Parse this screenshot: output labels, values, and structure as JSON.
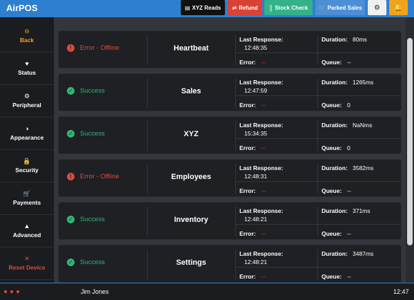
{
  "header": {
    "app_title": "AirPOS",
    "buttons": {
      "xyz_reads": {
        "label": "XYZ Reads",
        "icon": "receipt-icon"
      },
      "refund": {
        "label": "Refund",
        "icon": "refund-icon"
      },
      "stock_check": {
        "label": "Stock Check",
        "icon": "barcode-icon"
      },
      "parked_sales": {
        "label": "Parked Sales",
        "icon": "cart-icon"
      },
      "settings": {
        "icon": "gear-icon"
      },
      "notifications": {
        "icon": "bell-icon"
      }
    },
    "colors": {
      "bar": "#2f7fcf",
      "refund": "#d94336",
      "stock_check": "#33b28a",
      "parked_sales": "#4d8fd6",
      "notifications": "#f0a21e"
    }
  },
  "sidebar": {
    "items": [
      {
        "label": "Back",
        "icon": "back-icon"
      },
      {
        "label": "Status",
        "icon": "heart-pulse-icon"
      },
      {
        "label": "Peripheral",
        "icon": "gear-icon"
      },
      {
        "label": "Appearance",
        "icon": "contrast-icon"
      },
      {
        "label": "Security",
        "icon": "lock-icon"
      },
      {
        "label": "Payments",
        "icon": "cart-icon"
      },
      {
        "label": "Advanced",
        "icon": "warning-icon"
      },
      {
        "label": "Reset Device",
        "icon": "close-icon"
      }
    ]
  },
  "labels": {
    "last_response": "Last Response:",
    "duration": "Duration:",
    "error": "Error:",
    "queue": "Queue:"
  },
  "services": [
    {
      "status": "Error - Offline",
      "state": "error",
      "name": "Heartbeat",
      "last_response": "12:48:35",
      "duration": "80ms",
      "error": "--",
      "queue": "--"
    },
    {
      "status": "Success",
      "state": "success",
      "name": "Sales",
      "last_response": "12:47:59",
      "duration": "1265ms",
      "error": "--",
      "queue": "0"
    },
    {
      "status": "Success",
      "state": "success",
      "name": "XYZ",
      "last_response": "15:34:35",
      "duration": "NaNms",
      "error": "--",
      "queue": "0"
    },
    {
      "status": "Error - Offline",
      "state": "error",
      "name": "Employees",
      "last_response": "12:48:31",
      "duration": "3582ms",
      "error": "--",
      "queue": "--"
    },
    {
      "status": "Success",
      "state": "success",
      "name": "Inventory",
      "last_response": "12:48:21",
      "duration": "371ms",
      "error": "--",
      "queue": "--"
    },
    {
      "status": "Success",
      "state": "success",
      "name": "Settings",
      "last_response": "12:48:21",
      "duration": "3487ms",
      "error": "--",
      "queue": "--"
    }
  ],
  "status_colors": {
    "success": "#2fb872",
    "error": "#e04a3c"
  },
  "footer": {
    "user": "Jim Jones",
    "time": "12:47"
  }
}
